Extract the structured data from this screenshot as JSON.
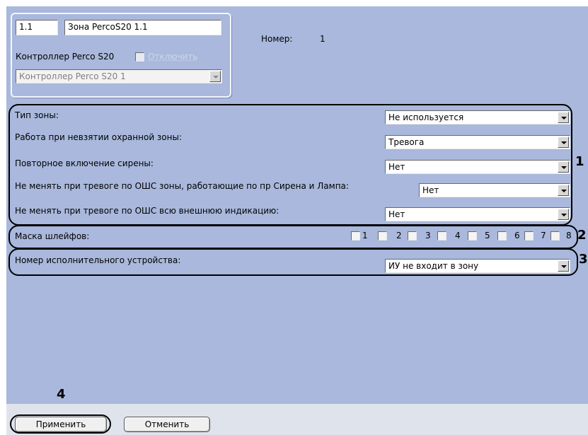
{
  "header": {
    "id_value": "1.1",
    "name_value": "Зона PercoS20 1.1",
    "number_label": "Номер:",
    "number_value": "1",
    "controller_label": "Контроллер Perco S20",
    "disable_label": "Отключить",
    "controller_select": "Контроллер Perco S20 1"
  },
  "settings": {
    "zone_type": {
      "label": "Тип зоны:",
      "value": "Не используется"
    },
    "unarmed_mode": {
      "label": "Работа при невзятии охранной зоны:",
      "value": "Тревога"
    },
    "siren_repeat": {
      "label": "Повторное включение сирены:",
      "value": "Нет"
    },
    "keep_zones": {
      "label": "Не менять при тревоге по ОШС зоны, работающие по пр Сирена и Лампа:",
      "value": "Нет"
    },
    "keep_indication": {
      "label": "Не менять при тревоге по ОШС всю внешнюю индикацию:",
      "value": "Нет"
    }
  },
  "loop_mask": {
    "label": "Маска шлейфов:",
    "items": [
      "1",
      "2",
      "3",
      "4",
      "5",
      "6",
      "7",
      "8"
    ]
  },
  "executive_device": {
    "label": "Номер исполнительного устройства:",
    "value": "ИУ не входит в зону"
  },
  "callouts": {
    "c1": "1",
    "c2": "2",
    "c3": "3",
    "c4": "4"
  },
  "buttons": {
    "apply": "Применить",
    "cancel": "Отменить"
  }
}
